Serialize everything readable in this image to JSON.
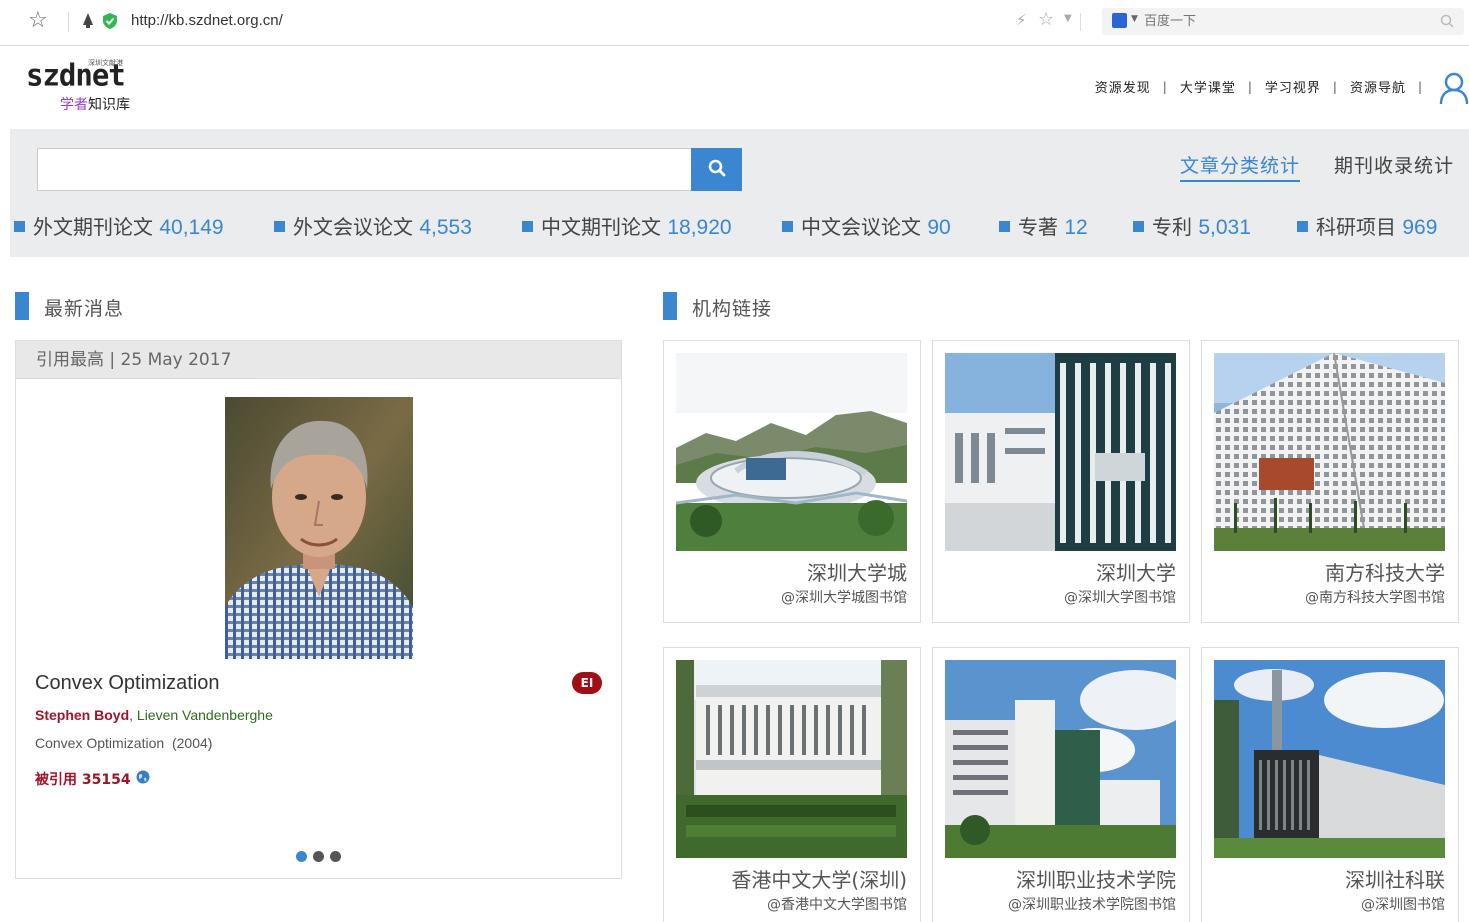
{
  "browser": {
    "url": "http://kb.szdnet.org.cn/",
    "search_placeholder": "百度一下"
  },
  "header": {
    "logo_text": "szdnet",
    "logo_tagline": "深圳文献港",
    "logo_sub_purple": "学者",
    "logo_sub_rest": "知识库",
    "nav": [
      "资源发现",
      "大学课堂",
      "学习视界",
      "资源导航"
    ],
    "nav_separator": "|"
  },
  "search": {
    "placeholder": "",
    "tabs": [
      "文章分类统计",
      "期刊收录统计"
    ],
    "stats": [
      {
        "label": "外文期刊论文",
        "count": "40,149"
      },
      {
        "label": "外文会议论文",
        "count": "4,553"
      },
      {
        "label": "中文期刊论文",
        "count": "18,920"
      },
      {
        "label": "中文会议论文",
        "count": "90"
      },
      {
        "label": "专著",
        "count": "12"
      },
      {
        "label": "专利",
        "count": "5,031"
      },
      {
        "label": "科研项目",
        "count": "969"
      }
    ]
  },
  "news": {
    "section_title": "最新消息",
    "card_header": "引用最高 | 25 May 2017",
    "paper_title": "Convex Optimization",
    "badge": "EI",
    "author_primary": "Stephen Boyd",
    "author_sep": ",",
    "author_secondary": " Lieven Vandenberghe",
    "journal": "Convex Optimization",
    "year": "(2004)",
    "cited": "被引用 35154"
  },
  "institutions": {
    "section_title": "机构链接",
    "items": [
      {
        "name": "深圳大学城",
        "library": "@深圳大学城图书馆"
      },
      {
        "name": "深圳大学",
        "library": "@深圳大学图书馆"
      },
      {
        "name": "南方科技大学",
        "library": "@南方科技大学图书馆"
      },
      {
        "name": "香港中文大学(深圳)",
        "library": "@香港中文大学图书馆"
      },
      {
        "name": "深圳职业技术学院",
        "library": "@深圳职业技术学院图书馆"
      },
      {
        "name": "深圳社科联",
        "library": "@深圳图书馆"
      }
    ]
  },
  "colors": {
    "accent": "#3a86d0",
    "panel_bg": "#ebeced",
    "author_red": "#a0142a",
    "author_green": "#2e6d1c",
    "badge_red": "#a00f15"
  }
}
